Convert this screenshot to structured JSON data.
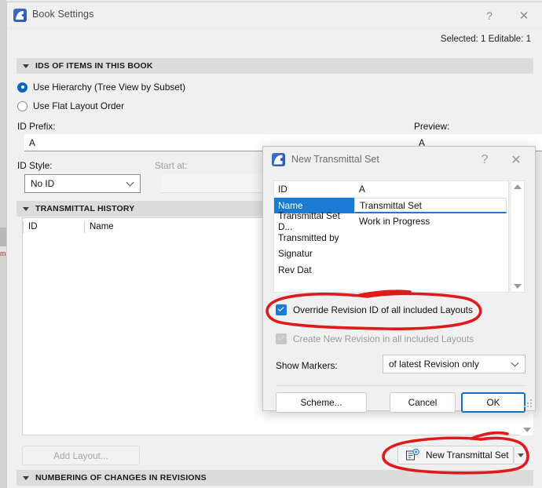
{
  "window": {
    "title": "Book Settings",
    "icon": "archicad-icon",
    "help_label": "?",
    "close_label": "✕",
    "status": "Selected: 1 Editable: 1"
  },
  "sections": {
    "ids": {
      "header": "IDS OF ITEMS IN THIS BOOK",
      "radio_hierarchy": "Use Hierarchy (Tree View by Subset)",
      "radio_flat": "Use Flat Layout Order",
      "id_prefix_label": "ID Prefix:",
      "id_prefix_value": "A",
      "preview_label": "Preview:",
      "preview_value": "A",
      "id_style_label": "ID Style:",
      "id_style_value": "No ID",
      "start_at_label": "Start at:",
      "start_at_value": ""
    },
    "history": {
      "header": "TRANSMITTAL HISTORY",
      "columns": [
        "ID",
        "Name"
      ],
      "rows": []
    },
    "numbering": {
      "header": "NUMBERING OF CHANGES IN REVISIONS"
    }
  },
  "footer": {
    "add_layout_label": "Add Layout...",
    "new_transmittal_label": "New Transmittal Set",
    "new_transmittal_icon": "new-document-plus-icon",
    "dropdown_arrow": "chevron-down-icon"
  },
  "modal": {
    "title": "New Transmittal Set",
    "icon": "archicad-icon",
    "help_label": "?",
    "close_label": "✕",
    "properties": [
      {
        "key": "ID",
        "value": "A",
        "selected": false
      },
      {
        "key": "Name",
        "value": "Transmittal Set",
        "selected": true
      },
      {
        "key": "Transmittal Set D...",
        "value": "Work in Progress",
        "selected": false
      },
      {
        "key": "Transmitted by",
        "value": "",
        "selected": false
      },
      {
        "key": "Signatur",
        "value": "",
        "selected": false
      },
      {
        "key": "Rev Dat",
        "value": "",
        "selected": false
      }
    ],
    "scrollbar": {
      "up": "scroll-up-arrow",
      "down": "scroll-down-arrow"
    },
    "checkbox_override": {
      "label": "Override Revision ID of all included Layouts",
      "checked": true,
      "enabled": true
    },
    "checkbox_create_new": {
      "label": "Create New Revision in all included Layouts",
      "checked": true,
      "enabled": false
    },
    "show_markers_label": "Show Markers:",
    "show_markers_value": "of latest Revision only",
    "buttons": {
      "scheme": "Scheme...",
      "cancel": "Cancel",
      "ok": "OK"
    }
  },
  "annotations": {
    "color": "#e01a1a",
    "marks": [
      {
        "name": "ellipse-around-override-checkbox"
      },
      {
        "name": "ellipse-around-new-transmittal-set-button"
      }
    ]
  },
  "colors": {
    "accent_blue": "#1a7bd4",
    "focus_blue": "#1570c4",
    "annotation_red": "#e01a1a",
    "window_bg": "#f0f0f0",
    "section_header_bg": "#dcdcdc"
  }
}
